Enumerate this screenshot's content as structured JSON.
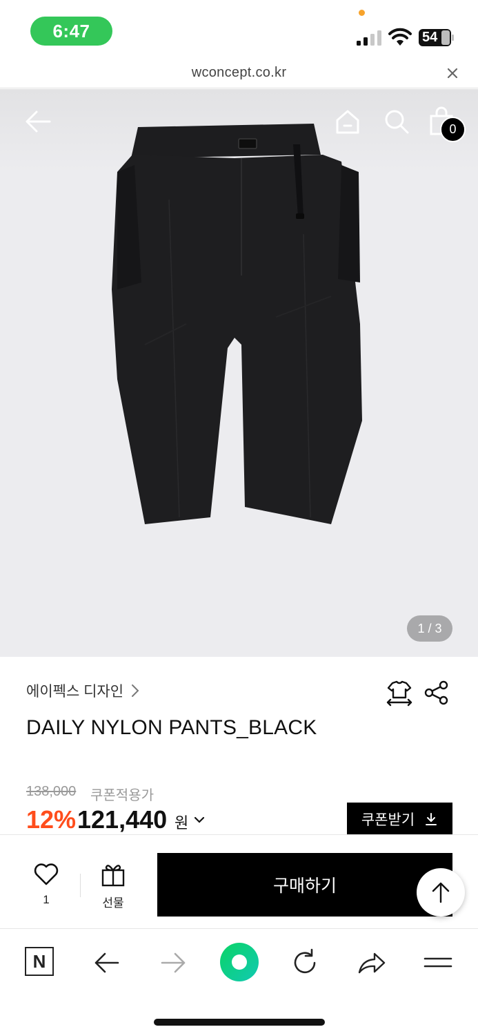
{
  "status_bar": {
    "time": "6:47",
    "battery": "54",
    "colors": {
      "time_pill": "#34c759",
      "dot": "#f7a32b"
    }
  },
  "browser": {
    "url": "wconcept.co.kr"
  },
  "hero": {
    "cart_count": "0",
    "pager": "1 / 3"
  },
  "product": {
    "brand": "에이펙스 디자인",
    "name": "DAILY NYLON PANTS_BLACK",
    "original_price": "138,000",
    "coupon_note": "쿠폰적용가",
    "discount": "12%",
    "price": "121,440",
    "currency": "원",
    "coupon_button": "쿠폰받기",
    "accent_color": "#ff4d1c"
  },
  "action_bar": {
    "like_count": "1",
    "gift_label": "선물",
    "buy_label": "구매하기"
  },
  "browser_toolbar": {
    "naver_label": "N"
  }
}
